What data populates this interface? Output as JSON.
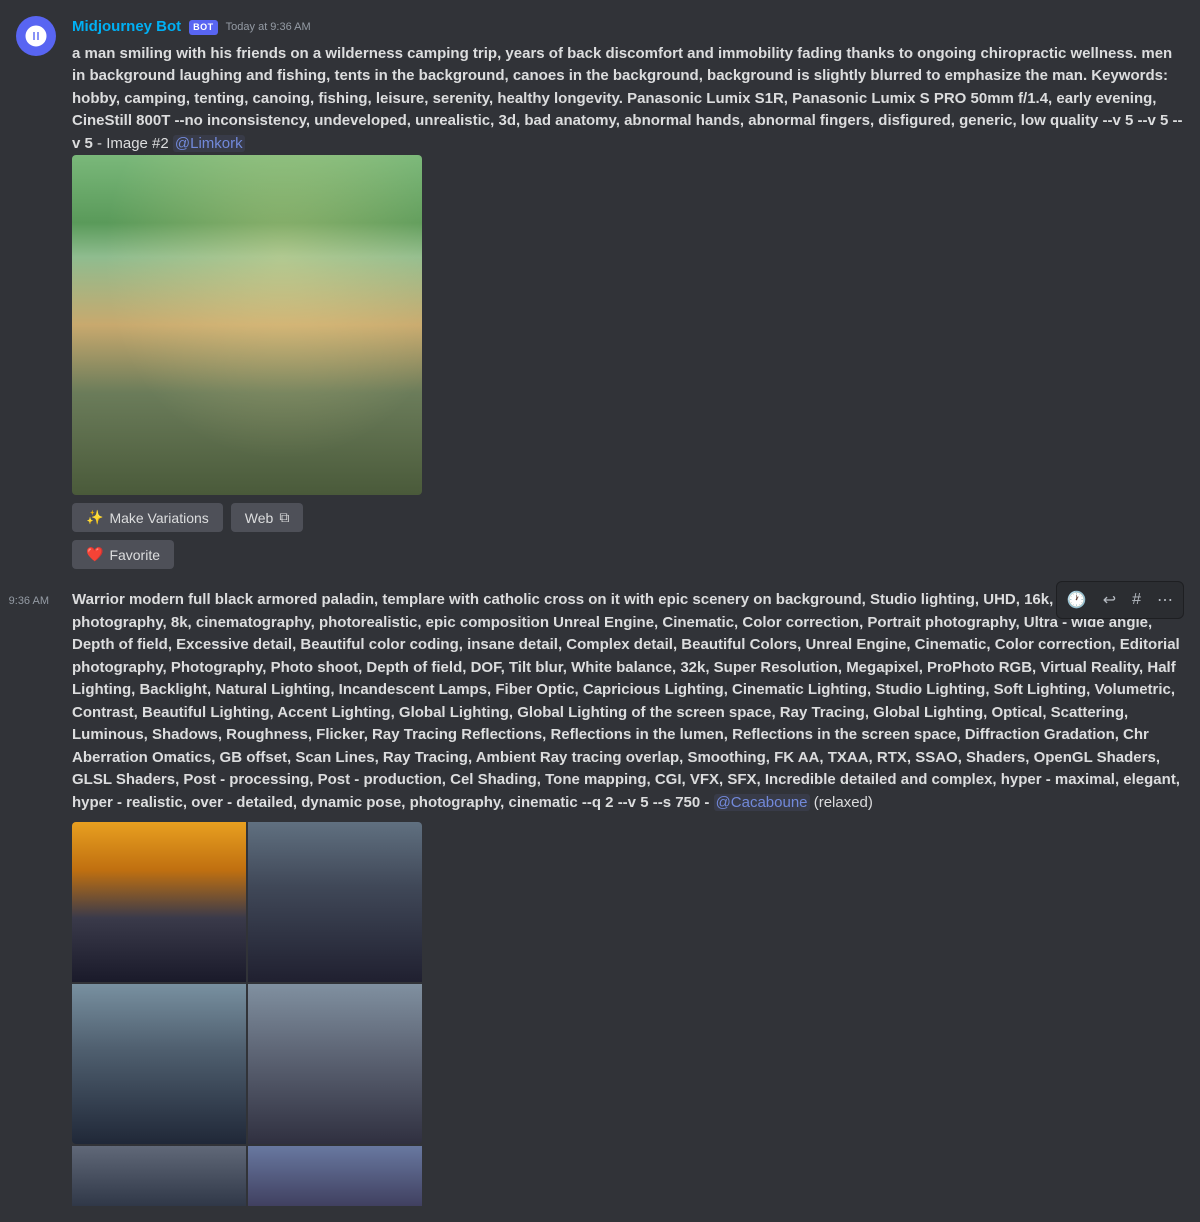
{
  "messages": [
    {
      "id": "msg1",
      "bot_name": "Midjourney Bot",
      "badge": "BOT",
      "timestamp": "Today at 9:36 AM",
      "content": "a man smiling with his friends on a wilderness camping trip, years of back discomfort and immobility fading thanks to ongoing chiropractic wellness. men in background laughing and fishing, tents in the background, canoes in the background, background is slightly blurred to emphasize the man. Keywords: hobby, camping, tenting, canoing, fishing, leisure, serenity, healthy longevity. Panasonic Lumix S1R, Panasonic Lumix S PRO 50mm f/1.4, early evening, CineStill 800T --no inconsistency, undeveloped, unrealistic, 3d, bad anatomy, abnormal hands, abnormal fingers, disfigured, generic, low quality --v 5 --v 5 --v 5",
      "suffix": " - Image #2 ",
      "mention": "@Limkork",
      "buttons": [
        {
          "label": "Make Variations",
          "icon": "✨",
          "type": "primary"
        },
        {
          "label": "Web",
          "icon": "⧉",
          "type": "secondary"
        }
      ],
      "favorite_button": "Favorite",
      "favorite_icon": "❤️"
    },
    {
      "id": "msg2",
      "timestamp": "9:36 AM",
      "content": "Warrior modern full black armored paladin, templare with catholic cross on it with epic scenery on background, Studio lighting, UHD, 16k, dream photography, 8k, cinematography, photorealistic, epic composition Unreal Engine, Cinematic, Color correction, Portrait photography, Ultra - wide angle, Depth of field, Excessive detail, Beautiful color coding, insane detail, Complex detail, Beautiful Colors, Unreal Engine, Cinematic, Color correction, Editorial photography, Photography, Photo shoot, Depth of field, DOF, Tilt blur, White balance, 32k, Super Resolution, Megapixel, ProPhoto RGB, Virtual Reality, Half Lighting, Backlight, Natural Lighting, Incandescent Lamps, Fiber Optic, Capricious Lighting, Cinematic Lighting, Studio Lighting, Soft Lighting, Volumetric, Contrast, Beautiful Lighting, Accent Lighting, Global Lighting, Global Lighting of the screen space, Ray Tracing, Global Lighting, Optical, Scattering, Luminous, Shadows, Roughness, Flicker, Ray Tracing Reflections, Reflections in the lumen, Reflections in the screen space, Diffraction Gradation, Chr Aberration Omatics, GB offset, Scan Lines, Ray Tracing, Ambient Ray tracing overlap, Smoothing, FK AA, TXAA, RTX, SSAO, Shaders, OpenGL Shaders, GLSL Shaders, Post - processing, Post - production, Cel Shading, Tone mapping, CGI, VFX, SFX, Incredible detailed and complex, hyper - maximal, elegant, hyper - realistic, over - detailed, dynamic pose, photography, cinematic --q 2 --v 5 --s 750 -",
      "mention": "@Cacaboune",
      "suffix": " (relaxed)",
      "actions": [
        {
          "icon": "🕐",
          "label": "clock"
        },
        {
          "icon": "↩",
          "label": "reply"
        },
        {
          "icon": "#",
          "label": "thread"
        },
        {
          "icon": "⋯",
          "label": "more"
        }
      ]
    }
  ]
}
